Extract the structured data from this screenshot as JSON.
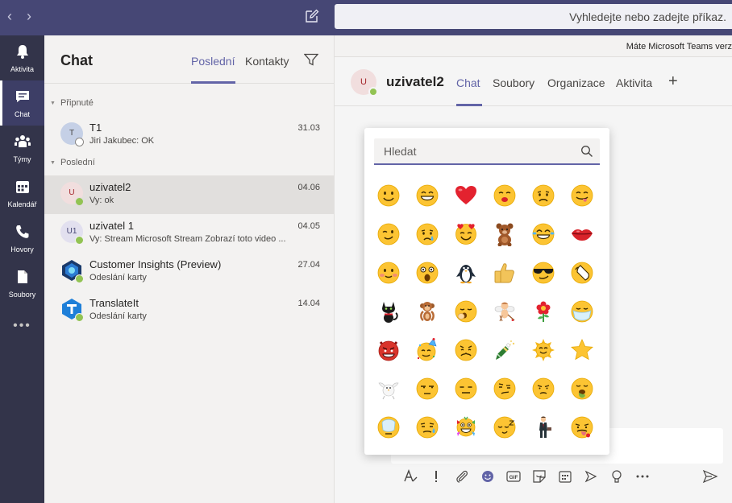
{
  "topbar": {
    "back_glyph": "‹",
    "forward_glyph": "›",
    "search_text": "Vyhledejte nebo zadejte příkaz."
  },
  "rail": {
    "items": [
      {
        "label": "Aktivita",
        "icon": "bell-icon"
      },
      {
        "label": "Chat",
        "icon": "chat-icon"
      },
      {
        "label": "Týmy",
        "icon": "teams-icon"
      },
      {
        "label": "Kalendář",
        "icon": "calendar-icon"
      },
      {
        "label": "Hovory",
        "icon": "phone-icon"
      },
      {
        "label": "Soubory",
        "icon": "files-icon"
      }
    ],
    "more": "•••"
  },
  "chatlist": {
    "title": "Chat",
    "tabs": [
      "Poslední",
      "Kontakty"
    ],
    "sections": {
      "pinned": "Připnuté",
      "recent": "Poslední"
    },
    "items": [
      {
        "initials": "T",
        "name": "T1",
        "preview": "Jiri Jakubec: OK",
        "date": "31.03",
        "status": "offline"
      },
      {
        "initials": "U",
        "name": "uzivatel2",
        "preview": "Vy: ok",
        "date": "04.06",
        "status": "available"
      },
      {
        "initials": "U1",
        "name": "uzivatel 1",
        "preview": "Vy: Stream Microsoft Stream Zobrazí toto video ...",
        "date": "04.05",
        "status": "available"
      },
      {
        "initials": "",
        "name": "Customer Insights (Preview)",
        "preview": "Odeslání karty",
        "date": "27.04",
        "status": "available"
      },
      {
        "initials": "",
        "name": "TranslateIt",
        "preview": "Odeslání karty",
        "date": "14.04",
        "status": "available"
      }
    ]
  },
  "banner": {
    "text": "Máte Microsoft Teams verz"
  },
  "conversation": {
    "avatar_initials": "U",
    "name": "uzivatel2",
    "tabs": [
      "Chat",
      "Soubory",
      "Organizace",
      "Aktivita"
    ],
    "add_glyph": "+"
  },
  "picker": {
    "search_placeholder": "Hledat"
  },
  "colors": {
    "accent": "#6264a7",
    "topbar": "#464775",
    "rail": "#33344a",
    "available": "#92c353"
  }
}
